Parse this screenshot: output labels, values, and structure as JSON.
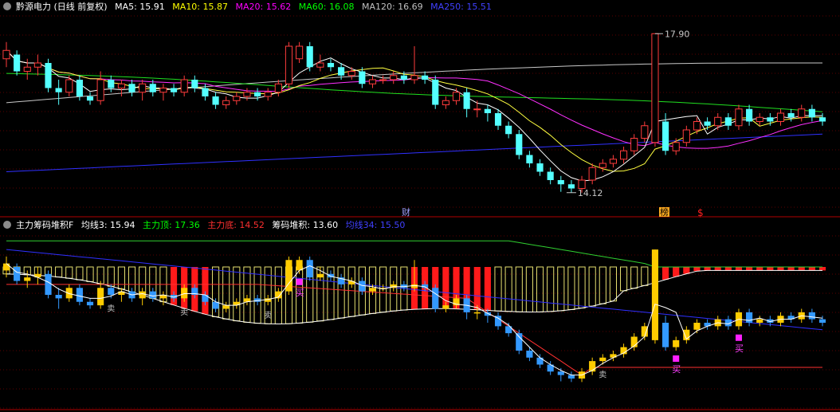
{
  "chart_data": [
    {
      "type": "candlestick",
      "title": "黔源电力 (日线 前复权)",
      "indicators": [
        {
          "name": "MA5",
          "label": "MA5: 15.91",
          "color": "#ffffff"
        },
        {
          "name": "MA10",
          "label": "MA10: 15.87",
          "color": "#ffff00"
        },
        {
          "name": "MA20",
          "label": "MA20: 15.62",
          "color": "#ff00ff"
        },
        {
          "name": "MA60",
          "label": "MA60: 16.08",
          "color": "#00ff00"
        },
        {
          "name": "MA120",
          "label": "MA120: 16.69",
          "color": "#c0c0c0"
        },
        {
          "name": "MA250",
          "label": "MA250: 15.51",
          "color": "#4040ff"
        }
      ],
      "ylim": [
        13.6,
        18.4
      ],
      "annotations": {
        "high": "17.90",
        "low": "14.12",
        "cai": "财",
        "bang": "榜",
        "dollar": "$"
      },
      "candles": [
        {
          "o": 17.3,
          "c": 17.5,
          "h": 17.7,
          "l": 17.1
        },
        {
          "o": 17.4,
          "c": 17.0,
          "h": 17.5,
          "l": 16.9
        },
        {
          "o": 17.0,
          "c": 17.1,
          "h": 17.3,
          "l": 16.8
        },
        {
          "o": 17.1,
          "c": 17.2,
          "h": 17.4,
          "l": 16.9
        },
        {
          "o": 17.2,
          "c": 16.6,
          "h": 17.3,
          "l": 16.5
        },
        {
          "o": 16.6,
          "c": 16.5,
          "h": 16.8,
          "l": 16.2
        },
        {
          "o": 16.5,
          "c": 16.8,
          "h": 16.9,
          "l": 16.4
        },
        {
          "o": 16.8,
          "c": 16.4,
          "h": 16.9,
          "l": 16.3
        },
        {
          "o": 16.4,
          "c": 16.3,
          "h": 16.5,
          "l": 16.2
        },
        {
          "o": 16.3,
          "c": 16.8,
          "h": 17.0,
          "l": 16.2
        },
        {
          "o": 16.8,
          "c": 16.6,
          "h": 16.9,
          "l": 16.5
        },
        {
          "o": 16.6,
          "c": 16.7,
          "h": 16.8,
          "l": 16.4
        },
        {
          "o": 16.7,
          "c": 16.5,
          "h": 16.8,
          "l": 16.4
        },
        {
          "o": 16.5,
          "c": 16.7,
          "h": 16.8,
          "l": 16.3
        },
        {
          "o": 16.7,
          "c": 16.5,
          "h": 16.8,
          "l": 16.4
        },
        {
          "o": 16.5,
          "c": 16.6,
          "h": 16.7,
          "l": 16.3
        },
        {
          "o": 16.6,
          "c": 16.5,
          "h": 16.7,
          "l": 16.4
        },
        {
          "o": 16.5,
          "c": 16.8,
          "h": 16.9,
          "l": 16.4
        },
        {
          "o": 16.8,
          "c": 16.6,
          "h": 16.9,
          "l": 16.5
        },
        {
          "o": 16.6,
          "c": 16.4,
          "h": 16.7,
          "l": 16.3
        },
        {
          "o": 16.4,
          "c": 16.2,
          "h": 16.5,
          "l": 16.1
        },
        {
          "o": 16.2,
          "c": 16.3,
          "h": 16.4,
          "l": 16.1
        },
        {
          "o": 16.3,
          "c": 16.4,
          "h": 16.5,
          "l": 16.2
        },
        {
          "o": 16.4,
          "c": 16.5,
          "h": 16.6,
          "l": 16.3
        },
        {
          "o": 16.5,
          "c": 16.4,
          "h": 16.6,
          "l": 16.3
        },
        {
          "o": 16.4,
          "c": 16.5,
          "h": 16.6,
          "l": 16.3
        },
        {
          "o": 16.5,
          "c": 16.7,
          "h": 16.8,
          "l": 16.4
        },
        {
          "o": 16.7,
          "c": 17.6,
          "h": 17.7,
          "l": 16.6
        },
        {
          "o": 17.3,
          "c": 17.6,
          "h": 17.7,
          "l": 17.2
        },
        {
          "o": 17.6,
          "c": 17.1,
          "h": 17.7,
          "l": 17.0
        },
        {
          "o": 17.1,
          "c": 17.2,
          "h": 17.4,
          "l": 17.0
        },
        {
          "o": 17.2,
          "c": 17.1,
          "h": 17.3,
          "l": 17.0
        },
        {
          "o": 17.1,
          "c": 16.9,
          "h": 17.2,
          "l": 16.8
        },
        {
          "o": 16.9,
          "c": 17.0,
          "h": 17.1,
          "l": 16.8
        },
        {
          "o": 17.0,
          "c": 16.7,
          "h": 17.1,
          "l": 16.6
        },
        {
          "o": 16.7,
          "c": 16.8,
          "h": 16.9,
          "l": 16.6
        },
        {
          "o": 16.8,
          "c": 16.8,
          "h": 16.9,
          "l": 16.7
        },
        {
          "o": 16.8,
          "c": 16.9,
          "h": 17.0,
          "l": 16.7
        },
        {
          "o": 16.9,
          "c": 16.8,
          "h": 17.0,
          "l": 16.7
        },
        {
          "o": 16.8,
          "c": 16.9,
          "h": 17.6,
          "l": 16.7
        },
        {
          "o": 16.9,
          "c": 16.8,
          "h": 17.0,
          "l": 16.7
        },
        {
          "o": 16.8,
          "c": 16.2,
          "h": 16.9,
          "l": 16.1
        },
        {
          "o": 16.2,
          "c": 16.3,
          "h": 16.4,
          "l": 16.1
        },
        {
          "o": 16.3,
          "c": 16.5,
          "h": 16.6,
          "l": 16.2
        },
        {
          "o": 16.5,
          "c": 16.1,
          "h": 16.6,
          "l": 15.9
        },
        {
          "o": 16.1,
          "c": 16.1,
          "h": 16.3,
          "l": 15.9
        },
        {
          "o": 16.1,
          "c": 16.0,
          "h": 16.2,
          "l": 15.8
        },
        {
          "o": 16.0,
          "c": 15.7,
          "h": 16.1,
          "l": 15.6
        },
        {
          "o": 15.7,
          "c": 15.5,
          "h": 15.8,
          "l": 15.4
        },
        {
          "o": 15.5,
          "c": 15.0,
          "h": 15.6,
          "l": 14.9
        },
        {
          "o": 15.0,
          "c": 14.8,
          "h": 15.1,
          "l": 14.7
        },
        {
          "o": 14.8,
          "c": 14.6,
          "h": 14.9,
          "l": 14.5
        },
        {
          "o": 14.6,
          "c": 14.4,
          "h": 14.7,
          "l": 14.3
        },
        {
          "o": 14.4,
          "c": 14.3,
          "h": 14.5,
          "l": 14.12
        },
        {
          "o": 14.3,
          "c": 14.2,
          "h": 14.4,
          "l": 14.1
        },
        {
          "o": 14.2,
          "c": 14.4,
          "h": 14.5,
          "l": 14.1
        },
        {
          "o": 14.4,
          "c": 14.7,
          "h": 14.8,
          "l": 14.3
        },
        {
          "o": 14.7,
          "c": 14.8,
          "h": 14.9,
          "l": 14.6
        },
        {
          "o": 14.8,
          "c": 14.9,
          "h": 15.0,
          "l": 14.7
        },
        {
          "o": 14.9,
          "c": 15.1,
          "h": 15.2,
          "l": 14.8
        },
        {
          "o": 15.1,
          "c": 15.4,
          "h": 15.5,
          "l": 15.0
        },
        {
          "o": 15.4,
          "c": 15.7,
          "h": 15.8,
          "l": 15.3
        },
        {
          "o": 15.3,
          "c": 17.9,
          "h": 17.9,
          "l": 15.2
        },
        {
          "o": 15.8,
          "c": 15.1,
          "h": 16.0,
          "l": 15.0
        },
        {
          "o": 15.1,
          "c": 15.3,
          "h": 15.4,
          "l": 15.0
        },
        {
          "o": 15.3,
          "c": 15.6,
          "h": 15.7,
          "l": 15.2
        },
        {
          "o": 15.6,
          "c": 15.8,
          "h": 15.9,
          "l": 15.5
        },
        {
          "o": 15.8,
          "c": 15.7,
          "h": 15.9,
          "l": 15.6
        },
        {
          "o": 15.7,
          "c": 15.9,
          "h": 16.0,
          "l": 15.6
        },
        {
          "o": 15.9,
          "c": 15.7,
          "h": 16.0,
          "l": 15.6
        },
        {
          "o": 15.7,
          "c": 16.1,
          "h": 16.2,
          "l": 15.6
        },
        {
          "o": 16.1,
          "c": 15.8,
          "h": 16.2,
          "l": 15.7
        },
        {
          "o": 15.8,
          "c": 15.9,
          "h": 16.0,
          "l": 15.7
        },
        {
          "o": 15.9,
          "c": 15.8,
          "h": 16.0,
          "l": 15.7
        },
        {
          "o": 15.8,
          "c": 16.0,
          "h": 16.1,
          "l": 15.7
        },
        {
          "o": 16.0,
          "c": 15.9,
          "h": 16.1,
          "l": 15.8
        },
        {
          "o": 15.9,
          "c": 16.1,
          "h": 16.2,
          "l": 15.8
        },
        {
          "o": 16.1,
          "c": 15.9,
          "h": 16.2,
          "l": 15.8
        },
        {
          "o": 15.9,
          "c": 15.8,
          "h": 16.0,
          "l": 15.7
        }
      ]
    },
    {
      "type": "bar",
      "title": "主力筹码堆积F",
      "indicators": [
        {
          "name": "均线3",
          "label": "均线3: 15.94",
          "color": "#ffffff"
        },
        {
          "name": "主力顶",
          "label": "主力顶: 17.36",
          "color": "#00ff00"
        },
        {
          "name": "主力底",
          "label": "主力底: 14.52",
          "color": "#ff3030"
        },
        {
          "name": "筹码堆积",
          "label": "筹码堆积: 13.60",
          "color": "#ffffff"
        },
        {
          "name": "均线34",
          "label": "均线34: 15.50",
          "color": "#4040ff"
        }
      ],
      "markers": {
        "buy": "买",
        "sell": "卖"
      }
    }
  ],
  "icons": {
    "top_settings": "gear-icon",
    "bottom_settings": "gear-icon"
  }
}
